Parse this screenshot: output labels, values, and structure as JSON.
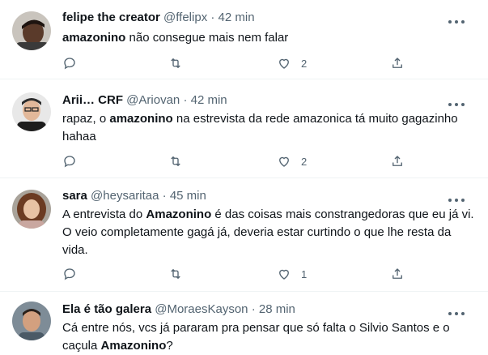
{
  "tweets": [
    {
      "name": "felipe the creator",
      "handle": "@ffelipx",
      "dot": "·",
      "time": "42 min",
      "text_parts": [
        [
          "amazonino",
          true
        ],
        [
          " não consegue mais nem falar",
          false
        ]
      ],
      "counts": {
        "reply": "",
        "retweet": "",
        "like": "2"
      },
      "avatar_colors": {
        "bg": "#c9c4bd",
        "skin": "#5a3a2a",
        "hair": "#1e1410",
        "shirt": "#3a3a3a"
      }
    },
    {
      "name": "Arii… CRF",
      "handle": "@Ariovan",
      "dot": "·",
      "time": "42 min",
      "text_parts": [
        [
          "rapaz, o ",
          false
        ],
        [
          "amazonino",
          true
        ],
        [
          " na estrevista da rede amazonica tá muito gagazinho hahaa",
          false
        ]
      ],
      "counts": {
        "reply": "",
        "retweet": "",
        "like": "2"
      },
      "avatar_colors": {
        "bg": "#e8e8e8",
        "skin": "#e2b89a",
        "hair": "#2b2b2b",
        "shirt": "#1d1d1d"
      }
    },
    {
      "name": "sara",
      "handle": "@heysaritaa",
      "dot": "·",
      "time": "45 min",
      "text_parts": [
        [
          "A entrevista do ",
          false
        ],
        [
          "Amazonino",
          true
        ],
        [
          " é das coisas mais constrangedoras que eu já vi. O veio completamente gagá já, deveria estar curtindo o que lhe resta da vida.",
          false
        ]
      ],
      "counts": {
        "reply": "",
        "retweet": "",
        "like": "1"
      },
      "avatar_colors": {
        "bg": "#a9a39a",
        "skin": "#e7c2a4",
        "hair": "#6b3b22",
        "shirt": "#c9a7a0"
      }
    },
    {
      "name": "Ela é tão galera",
      "handle": "@MoraesKayson",
      "dot": "·",
      "time": "28 min",
      "text_parts": [
        [
          "Cá entre nós, vcs já pararam pra pensar que só falta o Silvio Santos e o caçula ",
          false
        ],
        [
          "Amazonino",
          true
        ],
        [
          "?",
          false
        ]
      ],
      "counts": {
        "reply": "",
        "retweet": "",
        "like": ""
      },
      "avatar_colors": {
        "bg": "#7e8c97",
        "skin": "#d3a07f",
        "hair": "#2a201a",
        "shirt": "#4b5a66"
      }
    }
  ]
}
